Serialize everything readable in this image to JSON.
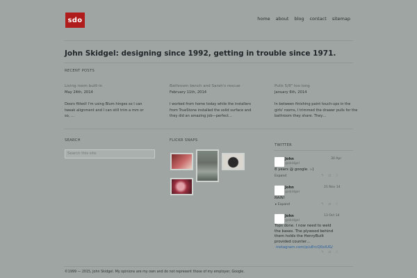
{
  "logo": {
    "text": "sdo"
  },
  "nav": [
    {
      "label": "home"
    },
    {
      "label": "about"
    },
    {
      "label": "blog"
    },
    {
      "label": "contact"
    },
    {
      "label": "sitemap"
    }
  ],
  "headline": "John Skidgel: designing since 1992, getting in trouble since 1971.",
  "recent_posts": {
    "heading": "RECENT POSTS",
    "items": [
      {
        "title": "Living room built-in",
        "date": "May 24th, 2014",
        "excerpt": "Doors fitted! I'm using Blum hinges so I can tweak alignment and I can still trim a mm or so, …"
      },
      {
        "title": "Bathroom bench and Sarah's rescue",
        "date": "February 11th, 2014",
        "excerpt": "I worked from home today while the installers from TrueStone installed the solid surface and they did an amazing job—perfect…"
      },
      {
        "title": "Pulls 5/8\" too long",
        "date": "January 6th, 2014",
        "excerpt": "In between finishing paint touch-ups in the girls' rooms, I trimmed the drawer pulls for the bathroom they share. They…"
      }
    ]
  },
  "search": {
    "heading": "SEARCH",
    "placeholder": "Search this site"
  },
  "flickr": {
    "heading": "FLICKR SNAPS"
  },
  "twitter": {
    "heading": "TWITTER",
    "tweets": [
      {
        "name": "John",
        "handle": "@skidgel",
        "date": "30 Apr",
        "text": "8 years @ google. :-)",
        "expand": "Expand",
        "link": ""
      },
      {
        "name": "John",
        "handle": "@skidgel",
        "date": "21 Nov 14",
        "text": "RAIN!",
        "expand": "Expand",
        "link": ""
      },
      {
        "name": "John",
        "handle": "@skidgel",
        "date": "13 Oct 14",
        "text": "Tops done. I now need to weld the bases. The plywood behind them holds the HenryBuilt provided counter…",
        "expand": "",
        "link": "instagram.com/p/uErcQ0xIUG/"
      }
    ]
  },
  "footer": "©1999 — 2015, John Skidgel. My opinions are my own and do not represent those of my employer, Google.",
  "colors": {
    "background": "#9ea5a2",
    "logo": "#b01b1b",
    "link": "#2a5fa0"
  }
}
